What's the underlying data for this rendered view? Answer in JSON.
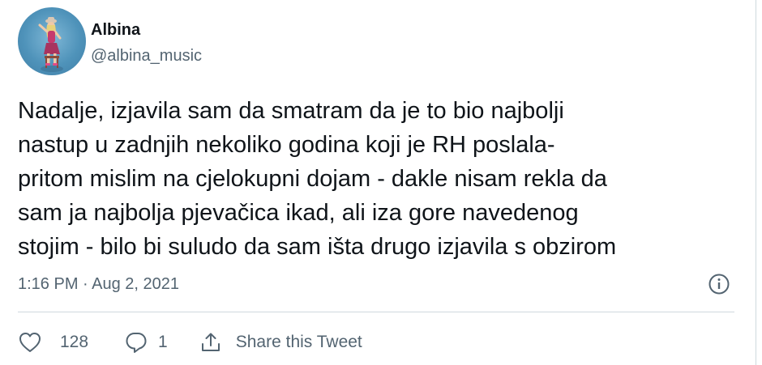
{
  "author": {
    "name": "Albina",
    "handle": "@albina_music"
  },
  "tweet": {
    "text": "Nadalje, izjavila sam da smatram da je to bio najbolji\nnastup u zadnjih nekoliko godina koji je RH poslala-\npritom mislim na cjelokupni dojam - dakle nisam rekla da\nsam ja najbolja pjevačica ikad, ali iza gore navedenog\nstojim - bilo bi suludo da sam išta drugo izjavila s obzirom",
    "timestamp": "1:16 PM · Aug 2, 2021"
  },
  "actions": {
    "like_count": "128",
    "reply_count": "1",
    "share_label": "Share this Tweet"
  },
  "icons": {
    "info": "info-icon",
    "like": "heart-icon",
    "reply": "reply-icon",
    "share": "share-icon"
  },
  "colors": {
    "text": "#0f1419",
    "secondary": "#536471",
    "divider": "#cfd9de"
  }
}
